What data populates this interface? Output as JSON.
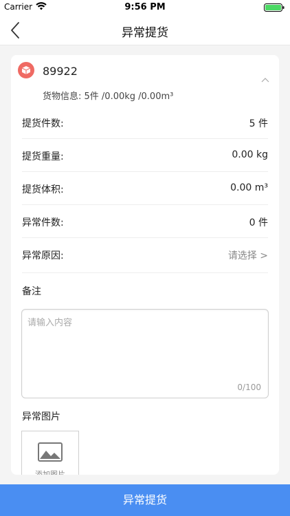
{
  "status_bar": {
    "carrier": "Carrier",
    "time": "9:56 PM"
  },
  "nav": {
    "title": "异常提货"
  },
  "order": {
    "number": "89922",
    "cargo_info": "货物信息: 5件 /0.00kg /0.00m³"
  },
  "rows": [
    {
      "label": "提货件数:",
      "value": "5 件"
    },
    {
      "label": "提货重量:",
      "value": "0.00 kg"
    },
    {
      "label": "提货体积:",
      "value": "0.00 m³"
    },
    {
      "label": "异常件数:",
      "value": "0 件"
    },
    {
      "label": "异常原因:",
      "value": "请选择 >"
    }
  ],
  "remark": {
    "label": "备注",
    "placeholder": "请输入内容",
    "counter": "0/100"
  },
  "photos": {
    "label": "异常图片",
    "add_label": "添加图片"
  },
  "submit_label": "异常提货",
  "colors": {
    "accent": "#4a8ef2",
    "order_icon": "#ef6a63",
    "battery": "#4cd964"
  }
}
